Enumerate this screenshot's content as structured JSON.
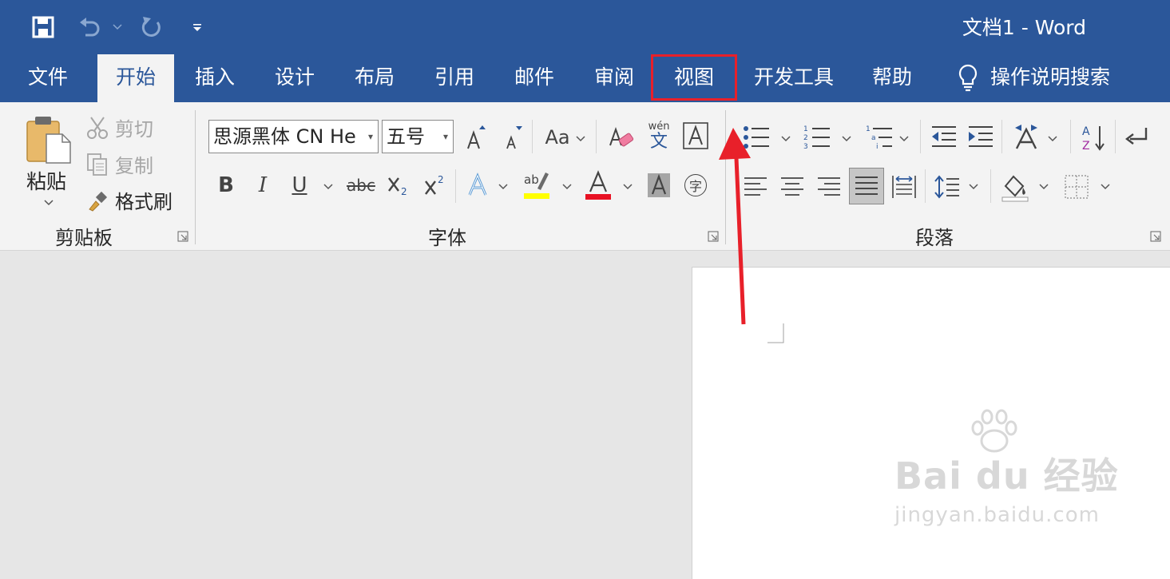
{
  "window": {
    "title": "文档1  -  Word"
  },
  "tabs": [
    {
      "label": "文件"
    },
    {
      "label": "开始"
    },
    {
      "label": "插入"
    },
    {
      "label": "设计"
    },
    {
      "label": "布局"
    },
    {
      "label": "引用"
    },
    {
      "label": "邮件"
    },
    {
      "label": "审阅"
    },
    {
      "label": "视图"
    },
    {
      "label": "开发工具"
    },
    {
      "label": "帮助"
    }
  ],
  "search": {
    "label": "操作说明搜索"
  },
  "clipboard": {
    "paste_label": "粘贴",
    "cut_label": "剪切",
    "copy_label": "复制",
    "format_painter_label": "格式刷",
    "group_label": "剪贴板"
  },
  "font": {
    "font_name": "思源黑体 CN He",
    "font_size": "五号",
    "change_case_label": "Aa",
    "phonetic_top": "wén",
    "phonetic_bottom": "文",
    "group_label": "字体",
    "bold": "B",
    "italic": "I",
    "underline": "U",
    "strike": "abc",
    "enclose_char": "字"
  },
  "paragraph": {
    "group_label": "段落"
  },
  "watermark": {
    "main": "Bai du 经验",
    "sub": "jingyan.baidu.com"
  },
  "colors": {
    "accent": "#2b579a",
    "highlight_box": "#e8202a",
    "arrow": "#e8202a",
    "highlight_yellow": "#ffff00",
    "font_red": "#e81123"
  }
}
